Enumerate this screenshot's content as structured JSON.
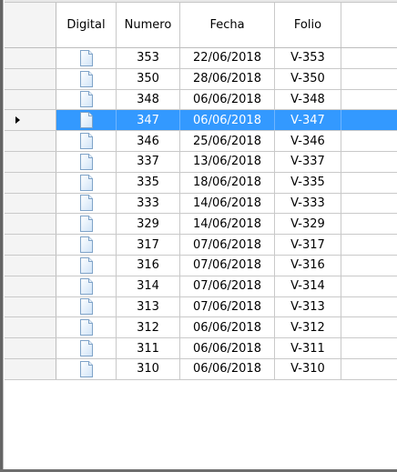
{
  "grid": {
    "columns": {
      "digital": "Digital",
      "numero": "Numero",
      "fecha": "Fecha",
      "folio": "Folio"
    },
    "selected_index": 3,
    "row_icon": "document-icon",
    "rows": [
      {
        "numero": "353",
        "fecha": "22/06/2018",
        "folio": "V-353"
      },
      {
        "numero": "350",
        "fecha": "28/06/2018",
        "folio": "V-350"
      },
      {
        "numero": "348",
        "fecha": "06/06/2018",
        "folio": "V-348"
      },
      {
        "numero": "347",
        "fecha": "06/06/2018",
        "folio": "V-347"
      },
      {
        "numero": "346",
        "fecha": "25/06/2018",
        "folio": "V-346"
      },
      {
        "numero": "337",
        "fecha": "13/06/2018",
        "folio": "V-337"
      },
      {
        "numero": "335",
        "fecha": "18/06/2018",
        "folio": "V-335"
      },
      {
        "numero": "333",
        "fecha": "14/06/2018",
        "folio": "V-333"
      },
      {
        "numero": "329",
        "fecha": "14/06/2018",
        "folio": "V-329"
      },
      {
        "numero": "317",
        "fecha": "07/06/2018",
        "folio": "V-317"
      },
      {
        "numero": "316",
        "fecha": "07/06/2018",
        "folio": "V-316"
      },
      {
        "numero": "314",
        "fecha": "07/06/2018",
        "folio": "V-314"
      },
      {
        "numero": "313",
        "fecha": "07/06/2018",
        "folio": "V-313"
      },
      {
        "numero": "312",
        "fecha": "06/06/2018",
        "folio": "V-312"
      },
      {
        "numero": "311",
        "fecha": "06/06/2018",
        "folio": "V-311"
      },
      {
        "numero": "310",
        "fecha": "06/06/2018",
        "folio": "V-310"
      }
    ]
  },
  "colors": {
    "selection": "#3399ff",
    "selection_text": "#ffffff",
    "gridline": "#c9c9c9"
  }
}
